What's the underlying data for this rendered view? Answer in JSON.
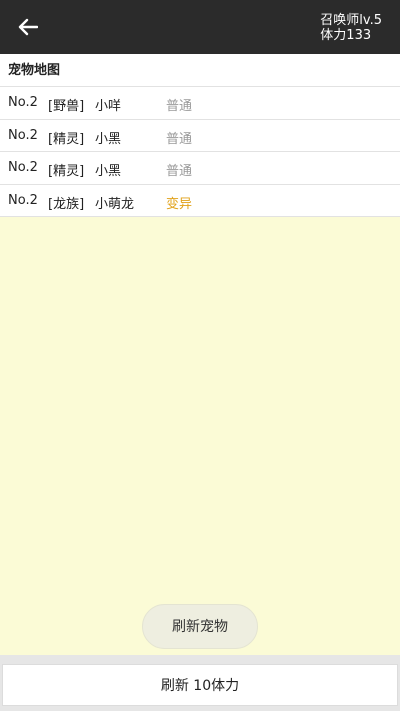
{
  "header": {
    "back_icon": "arrow-left-icon",
    "status_line1": "召唤师lv.5",
    "status_line2": "体力133"
  },
  "pet_map": {
    "title": "宠物地图",
    "rows": [
      {
        "no": "No.2",
        "category": "[野兽]",
        "name": "小咩",
        "quality": "普通"
      },
      {
        "no": "No.2",
        "category": "[精灵]",
        "name": "小黑",
        "quality": "普通"
      },
      {
        "no": "No.2",
        "category": "[精灵]",
        "name": "小黑",
        "quality": "普通"
      },
      {
        "no": "No.2",
        "category": "[龙族]",
        "name": "小萌龙",
        "quality": "变异"
      }
    ]
  },
  "buttons": {
    "refresh_pet": "刷新宠物",
    "refresh_cost": "刷新 10体力"
  },
  "colors": {
    "topbar": "#2b2b2b",
    "background": "#fbfbd6",
    "normal_quality": "#9a9a9a",
    "mutant_quality": "#e1a21a"
  }
}
